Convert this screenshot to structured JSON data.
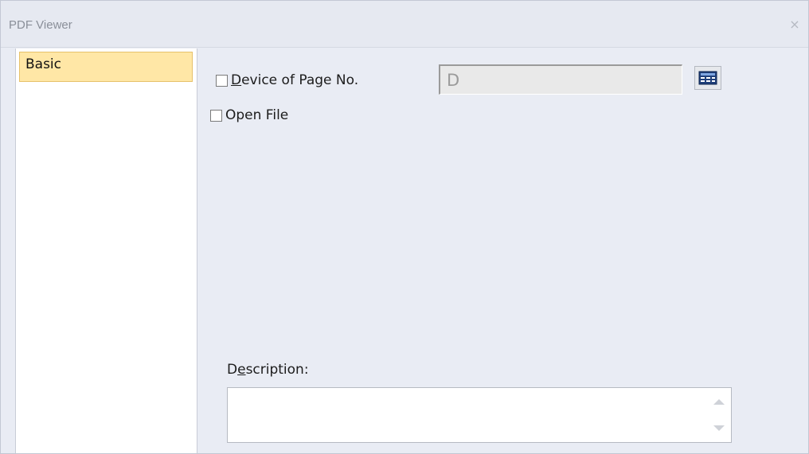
{
  "window": {
    "title": "PDF Viewer",
    "close_glyph": "×"
  },
  "sidebar": {
    "items": [
      {
        "label": "Basic",
        "selected": true
      }
    ]
  },
  "options": {
    "device_of_page_no": {
      "label_accel": "D",
      "label_rest": "evice of Page No.",
      "checked": false,
      "value": "D",
      "picker_icon": "device-list-icon"
    },
    "open_file": {
      "label": "Open File",
      "checked": false
    }
  },
  "description": {
    "label_pre": "D",
    "label_accel": "e",
    "label_rest": "scription:",
    "value": ""
  },
  "colors": {
    "selected_item": "#ffe7a6",
    "window_bg": "#e9ecf4"
  }
}
